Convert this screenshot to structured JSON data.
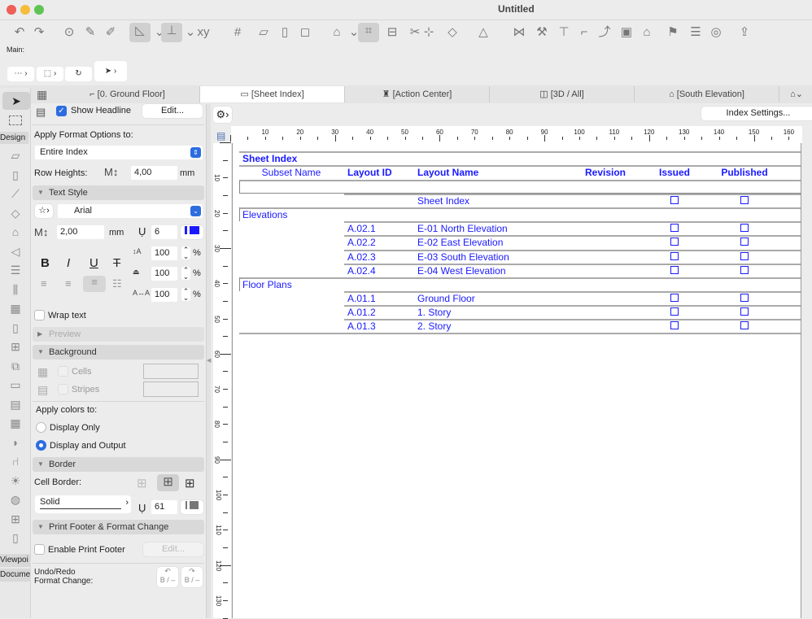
{
  "window": {
    "title": "Untitled"
  },
  "main_label": "Main:",
  "tabs": [
    {
      "label": "[0. Ground Floor]",
      "icon": "floor-plan-icon"
    },
    {
      "label": "[Sheet Index]",
      "icon": "sheet-icon",
      "active": true
    },
    {
      "label": "[Action Center]",
      "icon": "lighthouse-icon"
    },
    {
      "label": "[3D / All]",
      "icon": "cube-icon"
    },
    {
      "label": "[South Elevation]",
      "icon": "elevation-icon"
    }
  ],
  "toolbox": {
    "design": "Design",
    "viewpoint": "Viewpoi",
    "document": "Docume"
  },
  "panel": {
    "show_headline": "Show Headline",
    "show_headline_checked": true,
    "edit": "Edit...",
    "apply_format_label": "Apply Format Options to:",
    "apply_format_value": "Entire Index",
    "row_heights_label": "Row Heights:",
    "row_heights_value": "4,00",
    "mm": "mm",
    "text_style": "Text Style",
    "font": "Arial",
    "font_size": "2,00",
    "pen": "6",
    "bold": "B",
    "italic": "I",
    "underline": "U",
    "strike": "T",
    "width_pct": "100",
    "height_pct": "100",
    "spacing_pct": "100",
    "pct": "%",
    "wrap_text": "Wrap text",
    "preview": "Preview",
    "background": "Background",
    "cells": "Cells",
    "stripes": "Stripes",
    "apply_colors_label": "Apply colors to:",
    "display_only": "Display Only",
    "display_output": "Display and Output",
    "selected_apply": "Display and Output",
    "border": "Border",
    "cell_border_label": "Cell Border:",
    "line_type": "Solid",
    "border_pen": "61",
    "print_footer": "Print Footer & Format Change",
    "enable_footer": "Enable Print Footer",
    "footer_edit": "Edit...",
    "undo_redo_1": "Undo/Redo",
    "undo_redo_2": "Format Change:",
    "bi": "B / –"
  },
  "index_settings": "Index Settings...",
  "ruler": {
    "top": [
      10,
      20,
      30,
      40,
      50,
      60,
      70,
      80,
      90,
      100,
      110,
      120,
      130,
      140,
      150,
      160
    ],
    "left": [
      10,
      20,
      30,
      40,
      50,
      60,
      70,
      80,
      90,
      100,
      110,
      120,
      130
    ]
  },
  "table": {
    "title": "Sheet Index",
    "headers": [
      "Subset Name",
      "Layout ID",
      "Layout Name",
      "Revision",
      "Issued",
      "Published"
    ],
    "rows": [
      {
        "type": "empty"
      },
      {
        "type": "item",
        "id": "",
        "name": "Sheet Index"
      },
      {
        "type": "group",
        "name": "Elevations"
      },
      {
        "type": "item",
        "id": "A.02.1",
        "name": "E-01 North Elevation"
      },
      {
        "type": "item",
        "id": "A.02.2",
        "name": "E-02 East Elevation"
      },
      {
        "type": "item",
        "id": "A.02.3",
        "name": "E-03 South Elevation"
      },
      {
        "type": "item",
        "id": "A.02.4",
        "name": "E-04 West Elevation"
      },
      {
        "type": "group",
        "name": "Floor Plans"
      },
      {
        "type": "item",
        "id": "A.01.1",
        "name": "Ground Floor"
      },
      {
        "type": "item",
        "id": "A.01.2",
        "name": "1. Story"
      },
      {
        "type": "item",
        "id": "A.01.3",
        "name": "2. Story"
      }
    ]
  },
  "colors": {
    "table_text": "#1a1aff",
    "accent": "#2c6de0"
  }
}
